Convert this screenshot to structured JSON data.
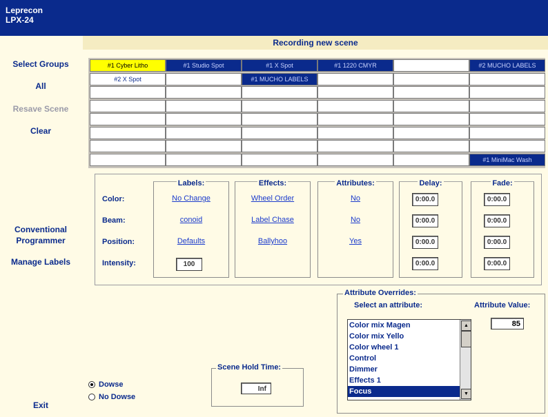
{
  "app": {
    "brand_line1": "Leprecon",
    "brand_line2": "LPX-24"
  },
  "scene": {
    "status": "Recording new scene"
  },
  "sidebar": {
    "select_groups": "Select Groups",
    "all": "All",
    "resave_scene": "Resave Scene",
    "clear": "Clear",
    "conventional_1": "Conventional",
    "conventional_2": "Programmer",
    "manage_labels": "Manage Labels",
    "exit": "Exit"
  },
  "grid": {
    "cells": [
      {
        "row": 0,
        "col": 0,
        "text": "#1 Cyber Litho",
        "state": "yellow"
      },
      {
        "row": 0,
        "col": 1,
        "text": "#1 Studio Spot",
        "state": "selected"
      },
      {
        "row": 0,
        "col": 2,
        "text": "#1 X Spot",
        "state": "selected"
      },
      {
        "row": 0,
        "col": 3,
        "text": "#1 1220 CMYR",
        "state": "selected"
      },
      {
        "row": 0,
        "col": 5,
        "text": "#2 MUCHO LABELS",
        "state": "selected"
      },
      {
        "row": 1,
        "col": 0,
        "text": "#2 X Spot",
        "state": "normal"
      },
      {
        "row": 1,
        "col": 2,
        "text": "#1 MUCHO LABELS",
        "state": "selected"
      },
      {
        "row": 7,
        "col": 5,
        "text": "#1 MiniMac Wash",
        "state": "selected"
      }
    ]
  },
  "panel": {
    "row_labels": [
      "Color:",
      "Beam:",
      "Position:",
      "Intensity:"
    ],
    "labels_title": "Labels:",
    "labels_values": [
      "No Change",
      "conoid",
      "Defaults"
    ],
    "intensity": "100",
    "effects_title": "Effects:",
    "effects_values": [
      "Wheel Order",
      "Label Chase",
      "Ballyhoo"
    ],
    "attributes_title": "Attributes:",
    "attributes_values": [
      "No",
      "No",
      "Yes"
    ],
    "delay_title": "Delay:",
    "delay_values": [
      "0:00.0",
      "0:00.0",
      "0:00.0",
      "0:00.0"
    ],
    "fade_title": "Fade:",
    "fade_values": [
      "0:00.0",
      "0:00.0",
      "0:00.0",
      "0:00.0"
    ]
  },
  "overrides": {
    "title": "Attribute Overrides:",
    "select_label": "Select an attribute:",
    "value_label": "Attribute Value:",
    "value": "85",
    "items": [
      "Color mix Magen",
      "Color mix Yello",
      "Color wheel 1",
      "Control",
      "Dimmer",
      "Effects 1",
      "Focus"
    ],
    "selected_index": 6
  },
  "hold": {
    "title": "Scene Hold Time:",
    "value": "Inf"
  },
  "dowse": {
    "option1": "Dowse",
    "option2": "No Dowse",
    "selected": "Dowse"
  },
  "colors": {
    "navy": "#0a2a8c",
    "background": "#fffbe6",
    "highlight": "#ffff00"
  }
}
